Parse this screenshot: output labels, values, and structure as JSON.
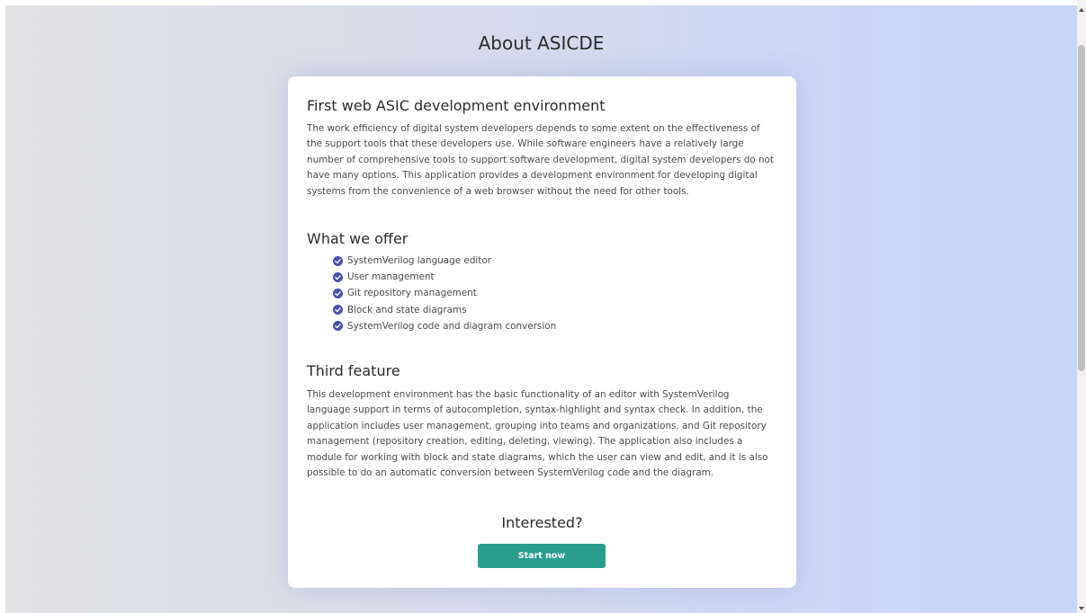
{
  "page": {
    "title": "About ASICDE"
  },
  "sections": [
    {
      "title": "First web ASIC development environment",
      "text": "The work efficiency of digital system developers depends to some extent on the effectiveness of the support tools that these developers use. While software engineers have a relatively large number of comprehensive tools to support software development, digital system developers do not have many options. This application provides a development environment for developing digital systems from the convenience of a web browser without the need for other tools."
    },
    {
      "title": "What we offer",
      "items": [
        "SystemVerilog language editor",
        "User management",
        "Git repository management",
        "Block and state diagrams",
        "SystemVerilog code and diagram conversion"
      ]
    },
    {
      "title": "Third feature",
      "text": "This development environment has the basic functionality of an editor with SystemVerilog language support in terms of autocompletion, syntax-highlight and syntax check. In addition, the application includes user management, grouping into teams and organizations, and Git repository management (repository creation, editing, deleting, viewing). The application also includes a module for working with block and state diagrams, which the user can view and edit, and it is also possible to do an automatic conversion between SystemVerilog code and the diagram."
    }
  ],
  "cta": {
    "title": "Interested?",
    "button_label": "Start now"
  },
  "icons": {
    "list_item": "check-circle-icon"
  },
  "colors": {
    "accent_button": "#2a9d8f",
    "check_icon": "#4b4fb0",
    "heading_text": "#2b2b2b",
    "body_text": "#4a4a4a"
  }
}
